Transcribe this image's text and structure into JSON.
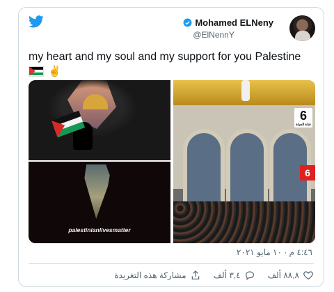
{
  "author": {
    "name": "Mohamed ELNeny",
    "handle": "@ElNennY"
  },
  "tweet": {
    "text": "my heart and my soul and my support for you  Palestine",
    "emoji": "✌"
  },
  "media": {
    "caption": "palestinianlivesmatter",
    "channel_number": "6",
    "channel_label": "قناة الحياة",
    "red_badge": "6"
  },
  "meta": {
    "timestamp": "٤:٤٦ م · ١٠ مايو ٢٠٢١"
  },
  "actions": {
    "likes": "٨٨,٨ ألف",
    "retweets": "٣,٤ ألف",
    "share": "مشاركة هذه التغريدة"
  },
  "colors": {
    "twitter_blue": "#1d9bf0",
    "muted": "#536471",
    "border": "#cfd9de"
  }
}
